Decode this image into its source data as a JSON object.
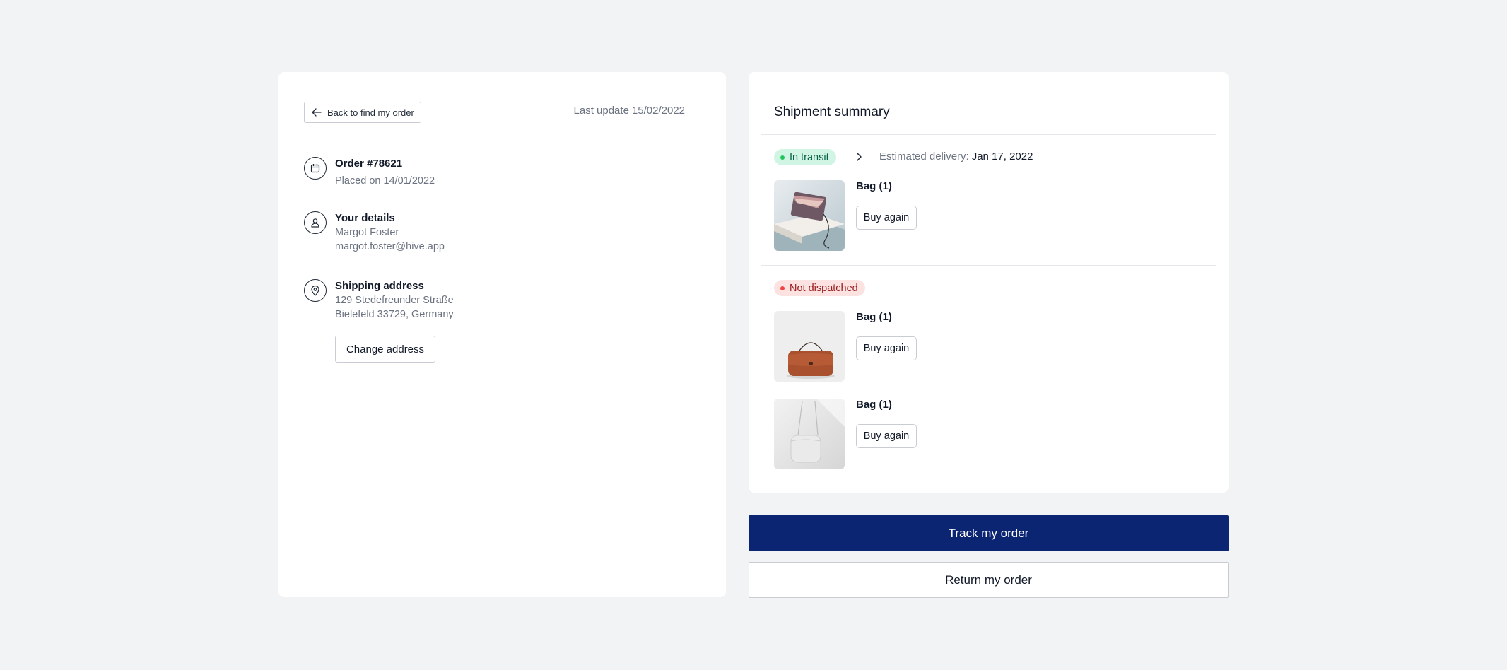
{
  "left": {
    "back_button": "Back to find my order",
    "last_update_label": "Last update",
    "last_update_value": "15/02/2022",
    "order": {
      "title": "Order #78621",
      "placed": "Placed on 14/01/2022",
      "icon": "calendar-icon"
    },
    "details": {
      "title": "Your details",
      "name": "Margot Foster",
      "email": "margot.foster@hive.app",
      "icon": "user-icon"
    },
    "shipping": {
      "title": "Shipping address",
      "line1": "129 Stedefreunder Straße",
      "line2": "Bielefeld 33729, Germany",
      "icon": "map-pin-icon",
      "change_button": "Change address"
    }
  },
  "shipment": {
    "title": "Shipment summary",
    "groups": [
      {
        "status": "In transit",
        "status_color": "#22c55e",
        "estimated_label": "Estimated delivery:",
        "estimated_date": "Jan 17, 2022",
        "items": [
          {
            "name": "Bag (1)",
            "button": "Buy again"
          }
        ]
      },
      {
        "status": "Not dispatched",
        "status_color": "#ef4444",
        "items": [
          {
            "name": "Bag (1)",
            "button": "Buy again"
          },
          {
            "name": "Bag (1)",
            "button": "Buy again"
          }
        ]
      }
    ]
  },
  "actions": {
    "track": "Track my order",
    "return": "Return my order",
    "track_color": "#0b2573"
  }
}
